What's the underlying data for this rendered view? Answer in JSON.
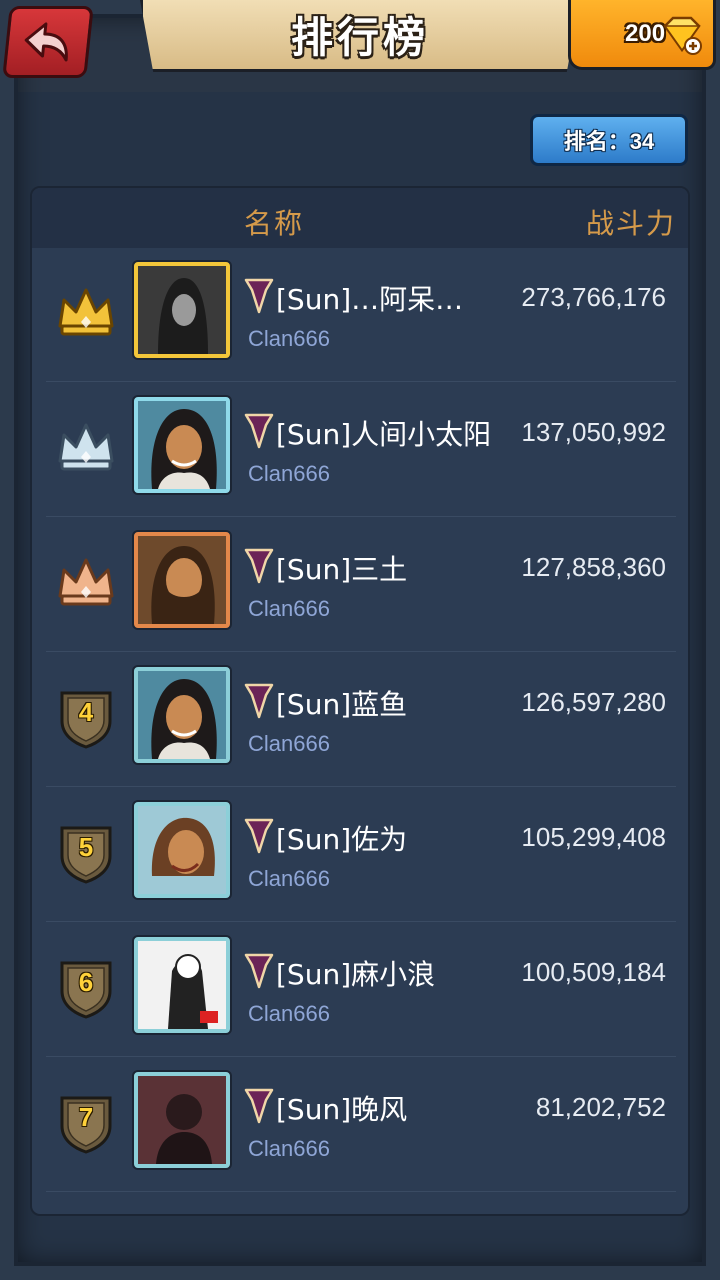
{
  "header": {
    "title": "排行榜",
    "gems": "200",
    "my_rank_label": "排名：34"
  },
  "columns": {
    "name": "名称",
    "power": "战斗力"
  },
  "colors": {
    "gold": "#f3c63a",
    "silver": "#8fdaea",
    "bronze": "#e4884a",
    "accent_header": "#d59a4a",
    "clan_text": "#8fa6d6"
  },
  "rows": [
    {
      "rank": "1",
      "rank_icon": "gold-crown-icon",
      "frame": "gold",
      "name": "[Sun]…阿呆…",
      "clan": "Clan666",
      "power": "273,766,176",
      "avatar": "hooded-figure-avatar"
    },
    {
      "rank": "2",
      "rank_icon": "silver-crown-icon",
      "frame": "silver",
      "name": "[Sun]人间小太阳",
      "clan": "Clan666",
      "power": "137,050,992",
      "avatar": "hero-avatar"
    },
    {
      "rank": "3",
      "rank_icon": "bronze-crown-icon",
      "frame": "bronze",
      "name": "[Sun]三土",
      "clan": "Clan666",
      "power": "127,858,360",
      "avatar": "bearded-hero-avatar"
    },
    {
      "rank": "4",
      "rank_icon": "rank-shield-icon",
      "frame": "normal",
      "name": "[Sun]蓝鱼",
      "clan": "Clan666",
      "power": "126,597,280",
      "avatar": "hero-avatar"
    },
    {
      "rank": "5",
      "rank_icon": "rank-shield-icon",
      "frame": "normal",
      "name": "[Sun]佐为",
      "clan": "Clan666",
      "power": "105,299,408",
      "avatar": "heroine-avatar"
    },
    {
      "rank": "6",
      "rank_icon": "rank-shield-icon",
      "frame": "normal",
      "name": "[Sun]麻小浪",
      "clan": "Clan666",
      "power": "100,509,184",
      "avatar": "sketch-avatar"
    },
    {
      "rank": "7",
      "rank_icon": "rank-shield-icon",
      "frame": "normal",
      "name": "[Sun]晚风",
      "clan": "Clan666",
      "power": "81,202,752",
      "avatar": "photo-avatar"
    }
  ]
}
